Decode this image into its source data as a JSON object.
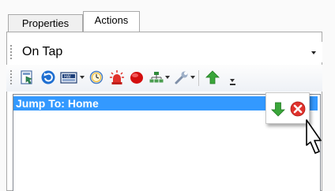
{
  "tabs": [
    {
      "label": "Properties",
      "active": false
    },
    {
      "label": "Actions",
      "active": true
    }
  ],
  "trigger_select": {
    "value": "On Tap"
  },
  "toolbar": {
    "icons": [
      "add-action-icon",
      "refresh-icon",
      "image-icon",
      "timer-icon",
      "alarm-icon",
      "record-icon",
      "hierarchy-icon",
      "wrench-icon",
      "move-up-icon",
      "overflow-chevron-icon"
    ]
  },
  "actions_list": {
    "items": [
      {
        "label": "Jump To: Home",
        "selected": true
      }
    ]
  },
  "row_popup": {
    "icons": [
      "move-down-icon",
      "delete-icon"
    ]
  },
  "colors": {
    "selection": "#3399ff",
    "up_arrow": "#3aa63a",
    "delete": "#e0322c"
  }
}
